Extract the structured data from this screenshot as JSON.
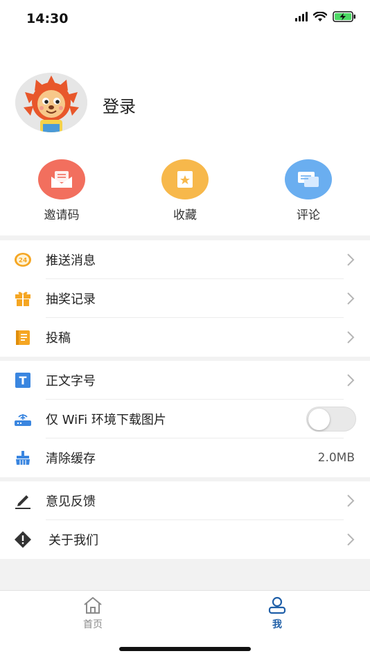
{
  "status_bar": {
    "time": "14:30",
    "icons": [
      "signal-icon",
      "wifi-icon",
      "battery-charging-icon"
    ],
    "battery_color": "#4cd964"
  },
  "profile": {
    "login_label": "登录",
    "avatar": "lion-mascot-avatar"
  },
  "quick_actions": [
    {
      "label": "邀请码",
      "icon": "invite-envelope-icon",
      "color": "#f26f5e"
    },
    {
      "label": "收藏",
      "icon": "favorite-star-icon",
      "color": "#f7b84b"
    },
    {
      "label": "评论",
      "icon": "comment-bubble-icon",
      "color": "#6aaef0"
    }
  ],
  "menu": {
    "group1": [
      {
        "label": "推送消息",
        "icon": "push-24-icon"
      },
      {
        "label": "抽奖记录",
        "icon": "gift-icon"
      },
      {
        "label": "投稿",
        "icon": "notebook-icon"
      }
    ],
    "group2": {
      "font_size": {
        "label": "正文字号",
        "icon": "text-size-icon"
      },
      "wifi_only": {
        "label": "仅 WiFi 环境下载图片",
        "icon": "router-icon",
        "enabled": false
      },
      "clear_cache": {
        "label": "清除缓存",
        "icon": "broom-icon",
        "value": "2.0MB"
      }
    },
    "group3": [
      {
        "label": "意见反馈",
        "icon": "pencil-icon"
      },
      {
        "label": "关于我们",
        "icon": "info-diamond-icon"
      }
    ]
  },
  "tabbar": {
    "home_label": "首页",
    "me_label": "我",
    "active_color": "#1f5fa8",
    "inactive_color": "#8a8a8a"
  }
}
